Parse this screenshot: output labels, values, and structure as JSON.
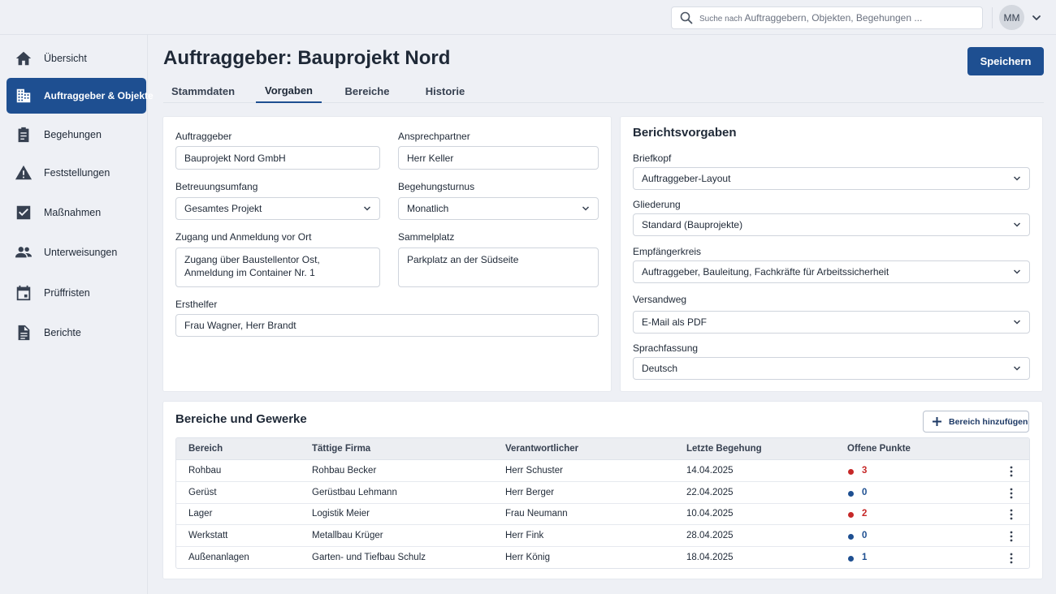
{
  "topbar": {
    "search_prefix": "Suche nach",
    "search_rest": "Auftraggebern, Objekten, Begehungen ...",
    "avatar_initials": "MM"
  },
  "sidebar": {
    "items": [
      {
        "label": "Übersicht",
        "icon": "home-icon"
      },
      {
        "label": "Auftraggeber & Objekte",
        "icon": "building-icon",
        "active": true
      },
      {
        "label": "Begehungen",
        "icon": "clipboard-icon"
      },
      {
        "label": "Feststellungen",
        "icon": "warning-icon"
      },
      {
        "label": "Maßnahmen",
        "icon": "checkbox-icon"
      },
      {
        "label": "Unterweisungen",
        "icon": "people-icon"
      },
      {
        "label": "Prüffristen",
        "icon": "calendar-icon"
      },
      {
        "label": "Berichte",
        "icon": "document-icon"
      }
    ]
  },
  "header": {
    "title": "Auftraggeber: Bauprojekt Nord",
    "save_label": "Speichern"
  },
  "tabs": [
    {
      "label": "Stammdaten"
    },
    {
      "label": "Vorgaben",
      "active": true
    },
    {
      "label": "Bereiche"
    },
    {
      "label": "Historie"
    }
  ],
  "form": {
    "auftraggeber_label": "Auftraggeber",
    "auftraggeber_value": "Bauprojekt Nord GmbH",
    "ansprechpartner_label": "Ansprechpartner",
    "ansprechpartner_value": "Herr Keller",
    "betreuungsumfang_label": "Betreuungsumfang",
    "betreuungsumfang_value": "Gesamtes Projekt",
    "begehungsturnus_label": "Begehungsturnus",
    "begehungsturnus_value": "Monatlich",
    "zugang_label": "Zugang und Anmeldung vor Ort",
    "zugang_value": "Zugang über Baustellentor Ost, Anmeldung im Container Nr. 1",
    "sammelplatz_label": "Sammelplatz",
    "sammelplatz_value": "Parkplatz an der Südseite",
    "ersthelfer_label": "Ersthelfer",
    "ersthelfer_value": "Frau Wagner, Herr Brandt"
  },
  "report": {
    "title": "Berichtsvorgaben",
    "briefkopf_label": "Briefkopf",
    "briefkopf_value": "Auftraggeber-Layout",
    "gliederung_label": "Gliederung",
    "gliederung_value": "Standard (Bauprojekte)",
    "empfaenger_label": "Empfängerkreis",
    "empfaenger_value": "Auftraggeber, Bauleitung, Fachkräfte für Arbeitssicherheit",
    "versandweg_label": "Versandweg",
    "versandweg_value": "E-Mail als PDF",
    "sprache_label": "Sprachfassung",
    "sprache_value": "Deutsch"
  },
  "areas": {
    "title": "Bereiche und Gewerke",
    "add_label": "Bereich hinzufügen",
    "columns": [
      "Bereich",
      "Tättige Firma",
      "Verantwortlicher",
      "Letzte Begehung",
      "Offene Punkte"
    ],
    "rows": [
      {
        "bereich": "Rohbau",
        "firma": "Rohbau Becker",
        "verantwortlicher": "Herr Schuster",
        "datum": "14.04.2025",
        "offen": "3",
        "status_color": "#c62828"
      },
      {
        "bereich": "Gerüst",
        "firma": "Gerüstbau Lehmann",
        "verantwortlicher": "Herr Berger",
        "datum": "22.04.2025",
        "offen": "0",
        "status_color": "#1e4f91"
      },
      {
        "bereich": "Lager",
        "firma": "Logistik Meier",
        "verantwortlicher": "Frau Neumann",
        "datum": "10.04.2025",
        "offen": "2",
        "status_color": "#c62828"
      },
      {
        "bereich": "Werkstatt",
        "firma": "Metallbau Krüger",
        "verantwortlicher": "Herr Fink",
        "datum": "28.04.2025",
        "offen": "0",
        "status_color": "#1e4f91"
      },
      {
        "bereich": "Außenanlagen",
        "firma": "Garten- und Tiefbau Schulz",
        "verantwortlicher": "Herr König",
        "datum": "18.04.2025",
        "offen": "1",
        "status_color": "#1e4f91"
      }
    ]
  },
  "colors": {
    "accent": "#1e4f91",
    "danger": "#c62828",
    "background": "#eef0f5"
  }
}
